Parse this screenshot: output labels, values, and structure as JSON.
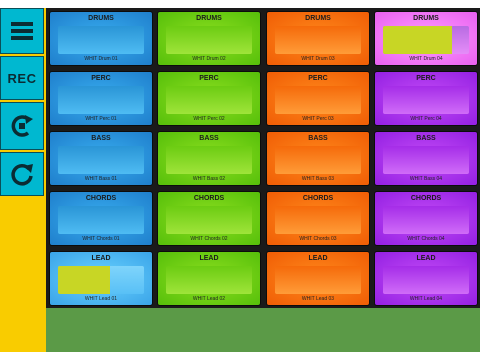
{
  "sidebar": {
    "rec_label": "REC",
    "accent": "#00b8d0",
    "background": "#f9cc00"
  },
  "pads": [
    {
      "title": "DRUMS",
      "sample": "WHIT Drum 01",
      "color": "blue",
      "progress": 0
    },
    {
      "title": "DRUMS",
      "sample": "WHIT Drum 02",
      "color": "green",
      "progress": 0
    },
    {
      "title": "DRUMS",
      "sample": "WHIT Drum 03",
      "color": "orange",
      "progress": 0
    },
    {
      "title": "DRUMS",
      "sample": "WHIT Drum 04",
      "color": "pink",
      "progress": 0.8
    },
    {
      "title": "PERC",
      "sample": "WHIT Perc 01",
      "color": "blue",
      "progress": 0
    },
    {
      "title": "PERC",
      "sample": "WHIT Perc 02",
      "color": "green",
      "progress": 0
    },
    {
      "title": "PERC",
      "sample": "WHIT Perc 03",
      "color": "orange",
      "progress": 0
    },
    {
      "title": "PERC",
      "sample": "WHIT Perc 04",
      "color": "purple",
      "progress": 0
    },
    {
      "title": "BASS",
      "sample": "WHIT Bass 01",
      "color": "blue",
      "progress": 0
    },
    {
      "title": "BASS",
      "sample": "WHIT Bass 02",
      "color": "green",
      "progress": 0
    },
    {
      "title": "BASS",
      "sample": "WHIT Bass 03",
      "color": "orange",
      "progress": 0
    },
    {
      "title": "BASS",
      "sample": "WHIT Bass 04",
      "color": "purple",
      "progress": 0
    },
    {
      "title": "CHORDS",
      "sample": "WHIT Chords 01",
      "color": "blue",
      "progress": 0
    },
    {
      "title": "CHORDS",
      "sample": "WHIT Chords 02",
      "color": "green",
      "progress": 0
    },
    {
      "title": "CHORDS",
      "sample": "WHIT Chords 03",
      "color": "orange",
      "progress": 0
    },
    {
      "title": "CHORDS",
      "sample": "WHIT Chords 04",
      "color": "purple",
      "progress": 0
    },
    {
      "title": "LEAD",
      "sample": "WHIT Lead 01",
      "color": "blue-hl",
      "progress": 0.6
    },
    {
      "title": "LEAD",
      "sample": "WHIT Lead 02",
      "color": "green",
      "progress": 0
    },
    {
      "title": "LEAD",
      "sample": "WHIT Lead 03",
      "color": "orange",
      "progress": 0
    },
    {
      "title": "LEAD",
      "sample": "WHIT Lead 04",
      "color": "purple",
      "progress": 0
    }
  ],
  "colors": {
    "blue": "#1f7fcc",
    "green": "#56bf0a",
    "orange": "#f05d05",
    "purple": "#9420e2",
    "pink": "#e860f0",
    "progress_fill": "#c8d625",
    "footer": "#5b9a47"
  },
  "icons": [
    "menu-icon",
    "loop-icon",
    "redo-icon"
  ]
}
